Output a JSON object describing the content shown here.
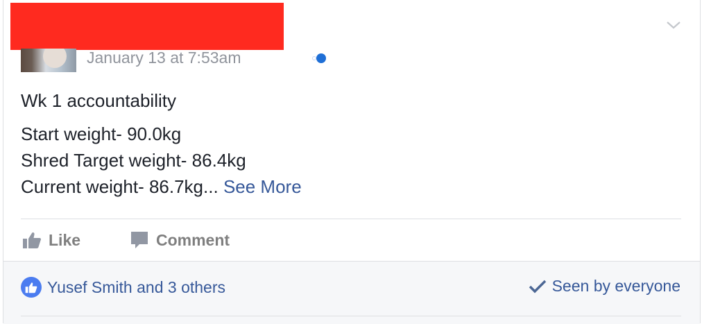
{
  "post": {
    "timestamp": "January 13 at 7:53am",
    "text_line1": "Wk 1 accountability",
    "text_line2": "Start weight- 90.0kg",
    "text_line3": "Shred Target weight- 86.4kg",
    "text_line4": "Current weight- 86.7kg...",
    "see_more_label": "See More"
  },
  "actions": {
    "like_label": "Like",
    "comment_label": "Comment"
  },
  "footer": {
    "reactions_text": "Yusef Smith and 3 others",
    "seen_text": "Seen by everyone"
  },
  "icons": {
    "options": "chevron-down-icon",
    "audience": "friends-audience-icon",
    "like": "thumbs-up-icon",
    "comment": "comment-bubble-icon",
    "reaction": "like-reaction-icon",
    "seen": "checkmark-icon"
  },
  "colors": {
    "link": "#365899",
    "redaction": "#ff2a1f",
    "like_badge": "#4b7cf0"
  }
}
